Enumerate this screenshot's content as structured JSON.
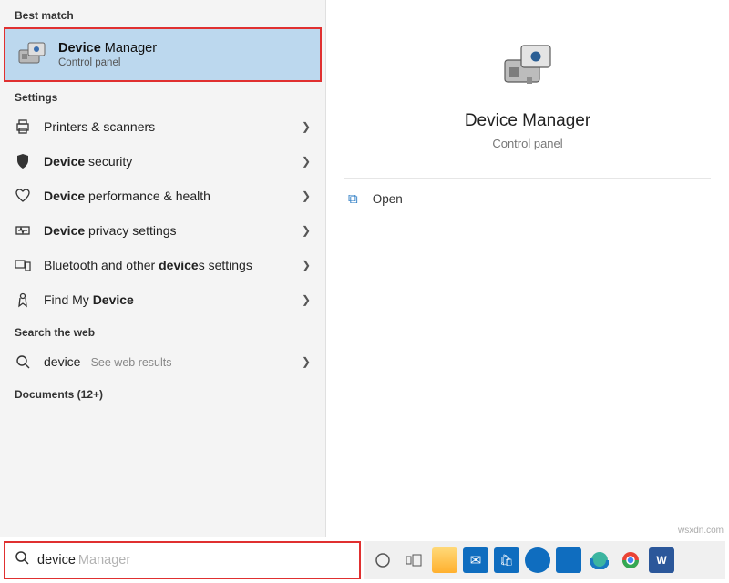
{
  "sections": {
    "best_match": "Best match",
    "settings": "Settings",
    "search_web": "Search the web",
    "documents": "Documents (12+)"
  },
  "best_match_item": {
    "title_bold": "Device",
    "title_rest": " Manager",
    "subtitle": "Control panel"
  },
  "settings_items": [
    {
      "label_pre": "Printers & scanners",
      "bold": "",
      "label_post": ""
    },
    {
      "label_pre": "",
      "bold": "Device",
      "label_post": " security"
    },
    {
      "label_pre": "",
      "bold": "Device",
      "label_post": " performance & health"
    },
    {
      "label_pre": "",
      "bold": "Device",
      "label_post": " privacy settings"
    },
    {
      "label_pre": "Bluetooth and other ",
      "bold": "device",
      "label_post": "s settings"
    },
    {
      "label_pre": "Find My ",
      "bold": "Device",
      "label_post": ""
    }
  ],
  "web_item": {
    "query": "device",
    "suffix": " - See web results"
  },
  "right": {
    "title": "Device Manager",
    "subtitle": "Control panel",
    "open_label": "Open"
  },
  "search": {
    "typed": "device",
    "ghost": " Manager"
  },
  "watermark": "wsxdn.com"
}
